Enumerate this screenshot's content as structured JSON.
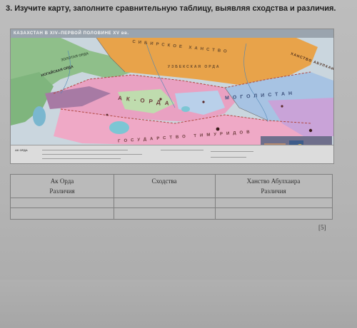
{
  "task": {
    "number": "3.",
    "text": "Изучите карту, заполните сравнительную таблицу, выявляя сходства и различия."
  },
  "map": {
    "title": "КАЗАХСТАН В XIV–ПЕРВОЙ ПОЛОВИНЕ XV вв.",
    "labels": {
      "ak_orda": "АК-ОРДА",
      "state": "ГОСУДАРСТВО ТИМУРИДОВ",
      "khanate": "ХАНСТВО АБУЛХАИРА",
      "nogai": "НОГАЙСКАЯ ОРДА",
      "mogulistan": "МОГОЛИСТАН",
      "uzbek": "УЗБЕКСКАЯ ОРДА",
      "siberian": "СИБИРСКОЕ ХАНСТВО",
      "golden": "ЗОЛОТАЯ ОРДА"
    },
    "legend_head": "АК ОРДА"
  },
  "table": {
    "col1_header": "Ак Орда",
    "col1_sub": "Различия",
    "col2_header": "Сходства",
    "col3_header": "Ханство Абулхаира",
    "col3_sub": "Различия"
  },
  "score": "[5]"
}
